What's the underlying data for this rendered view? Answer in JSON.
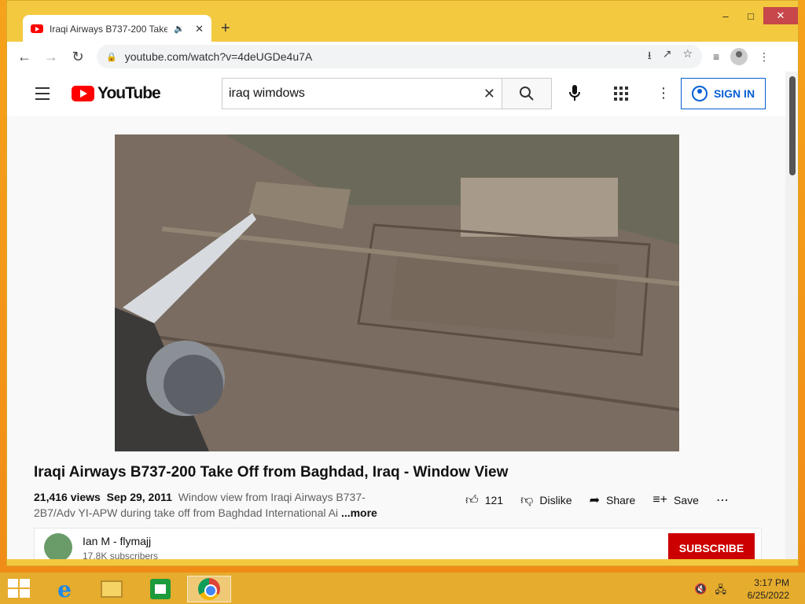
{
  "browser": {
    "tab_title": "Iraqi Airways B737-200 Take",
    "url": "youtube.com/watch?v=4deUGDe4u7A",
    "new_tab_symbol": "+"
  },
  "youtube": {
    "logo_text": "YouTube",
    "search_query": "iraq wimdows",
    "sign_in_label": "SIGN IN",
    "video": {
      "title": "Iraqi Airways B737-200 Take Off from Baghdad, Iraq - Window View",
      "views": "21,416 views",
      "date": "Sep 29, 2011",
      "description": "Window view from Iraqi Airways B737-2B7/Adv YI-APW during take off from Baghdad International Ai",
      "more_label": "...more",
      "like_count": "121",
      "dislike_label": "Dislike",
      "share_label": "Share",
      "save_label": "Save"
    },
    "channel": {
      "name": "Ian M - flymajj",
      "subscribers": "17.8K subscribers",
      "subscribe_label": "SUBSCRIBE"
    }
  },
  "taskbar": {
    "time": "3:17 PM",
    "date": "6/25/2022"
  },
  "colors": {
    "accent_youtube": "#ff0000",
    "subscribe": "#cc0000",
    "signin": "#065fd4",
    "desktop": "#f08b16",
    "window_frame": "#f3c93f"
  }
}
